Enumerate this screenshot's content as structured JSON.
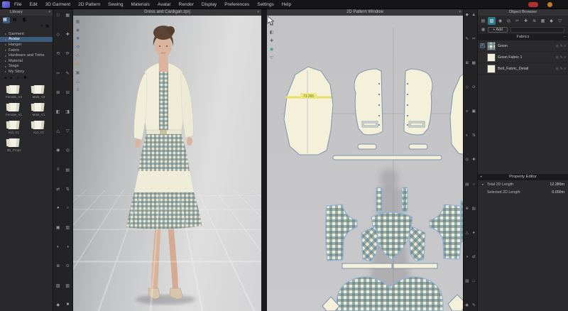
{
  "menu_bar": {
    "items": [
      "File",
      "Edit",
      "3D Garment",
      "2D Pattern",
      "Sewing",
      "Materials",
      "Avatar",
      "Render",
      "Display",
      "Preferences",
      "Settings",
      "Help"
    ]
  },
  "glyphs": {
    "caret_down": "▾",
    "bullet": "▸",
    "back": "◂",
    "forward": "▸",
    "home": "⌂",
    "plus": "✚",
    "check": "✓",
    "menu": "≡",
    "grid": "▦",
    "list": "▤",
    "split": "◧",
    "minus": "−",
    "eye": "◎",
    "edit": "✎",
    "save": "▤",
    "collapse": "◂",
    "resize": "↔"
  },
  "library": {
    "title": "Library",
    "tree": [
      {
        "label": "Garment"
      },
      {
        "label": "Avatar",
        "selected": true
      },
      {
        "label": "Hanger"
      },
      {
        "label": "Fabric"
      },
      {
        "label": "Hardware and Trims"
      },
      {
        "label": "Material"
      },
      {
        "label": "Stage"
      },
      {
        "label": "My Story"
      }
    ],
    "folders": [
      "Female_V2",
      "Male_V2",
      "Female_V1",
      "Male_V1",
      "Kid_V1",
      "Kid_V2",
      "3D_Props"
    ]
  },
  "toolbars": {
    "main_left": [
      "□",
      "▦",
      "◇",
      "✚",
      "⟲",
      "⟳",
      "✂",
      "✎",
      "⊞",
      "⊟",
      "◧",
      "◨",
      "△",
      "▽",
      "◉",
      "◎",
      "≡",
      "▤",
      "⇄",
      "⇅",
      "●",
      "○",
      "▣",
      "▥",
      "◐",
      "◑",
      "⊕",
      "⊙",
      "▨",
      "▧",
      "◆",
      "■"
    ],
    "vp3d": [
      {
        "g": "▦",
        "c": "#5f6670"
      },
      {
        "g": "◉",
        "c": "#5f6670"
      },
      {
        "g": "✚",
        "c": "#3f6f9e"
      },
      {
        "g": "⟲",
        "c": "#3f6f9e"
      },
      {
        "g": "◇",
        "c": "#5f6670"
      },
      {
        "g": "⊙",
        "c": "#c28a2d"
      },
      {
        "g": "▣",
        "c": "#5f6670"
      },
      {
        "g": "△",
        "c": "#5f6670"
      },
      {
        "g": "≡",
        "c": "#5f6670"
      }
    ],
    "vp2d": [
      {
        "g": "▤",
        "c": "#5f6670"
      },
      {
        "g": "◧",
        "c": "#5f6670"
      },
      {
        "g": "✚",
        "c": "#5f6670"
      },
      {
        "g": "◉",
        "c": "#2e9d8a"
      },
      {
        "g": "▽",
        "c": "#5f6670"
      }
    ],
    "right_strip": [
      "◆",
      "▲",
      "✎",
      "✂",
      "⊞",
      "▦",
      "◇",
      "⊙",
      "≡",
      "▣",
      "◐",
      "⇅",
      "◎",
      "✚",
      "▤",
      "○",
      "⊕",
      "▥",
      "△",
      "●",
      "◑",
      "⇄",
      "▨",
      "□",
      "◉",
      "✎"
    ]
  },
  "vp3d": {
    "title": "Dress and Cardigan.zprj"
  },
  "vp2d": {
    "title": "2D Pattern Window",
    "measure": "73.265"
  },
  "object_browser": {
    "title": "Object Browser",
    "tabs": [
      {
        "g": "▤"
      },
      {
        "g": "▨",
        "active": true
      },
      {
        "g": "◉"
      },
      {
        "g": "◎"
      },
      {
        "g": "✂"
      },
      {
        "g": "✚"
      },
      {
        "g": "≋"
      },
      {
        "g": "▦"
      },
      {
        "g": "◆"
      },
      {
        "g": "▽"
      }
    ],
    "add_button": "+ Add",
    "section": "Fabrics",
    "fabrics": [
      {
        "name": "Gown",
        "checked": true,
        "gingham": true
      },
      {
        "name": "Gown Fabric 1"
      },
      {
        "name": "Belt_Fabric_Detail"
      }
    ]
  },
  "property_editor": {
    "title": "Property Editor",
    "rows": [
      {
        "arrow": "▸",
        "label": "Total 2D Length",
        "value": "12.289m"
      },
      {
        "arrow": "",
        "label": "Selected 2D Length",
        "value": "0.000m"
      }
    ]
  },
  "colors": {
    "accent_teal": "#2e7d8c",
    "selection_blue": "#3c5a7a",
    "pattern_outline": "#7c95ae",
    "gingham_teal": "#5d7f88",
    "cream": "#f2eeda",
    "measure_yellow": "#e8e060"
  }
}
